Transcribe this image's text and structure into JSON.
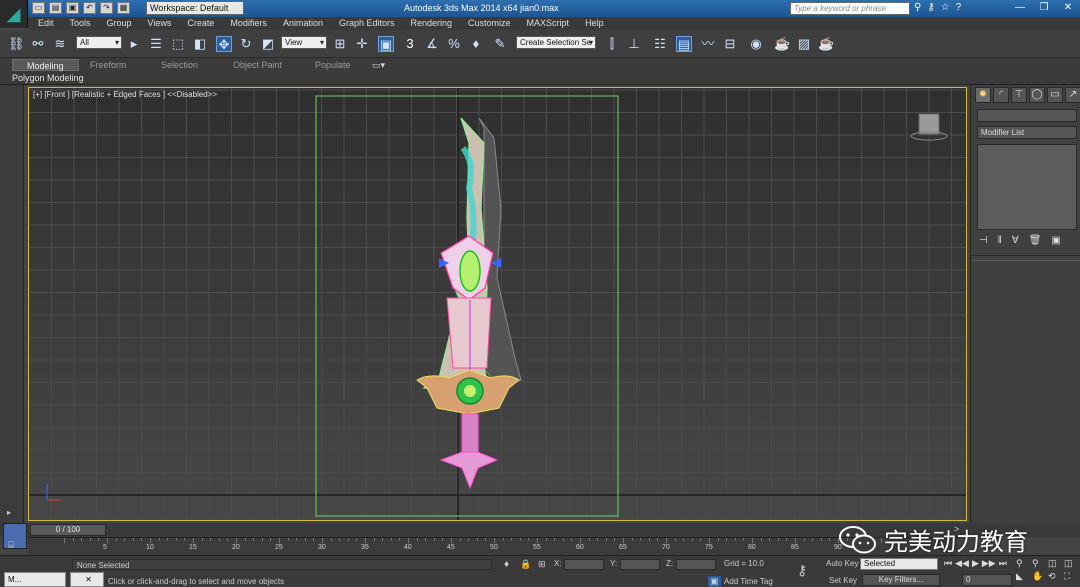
{
  "titlebar": {
    "workspace": "Workspace: Default",
    "title": "Autodesk 3ds Max  2014 x64      jian0.max",
    "search_placeholder": "Type a keyword or phrase"
  },
  "menu": [
    "Edit",
    "Tools",
    "Group",
    "Views",
    "Create",
    "Modifiers",
    "Animation",
    "Graph Editors",
    "Rendering",
    "Customize",
    "MAXScript",
    "Help"
  ],
  "toolbar": {
    "filter_value": "All",
    "refcoord_value": "View",
    "snap_label": "3",
    "named_selection_placeholder": "Create Selection Se"
  },
  "ribbon": {
    "tabs": [
      "Modeling",
      "Freeform",
      "Selection",
      "Object Paint",
      "Populate"
    ],
    "active_tab": "Modeling",
    "panel_title": "Polygon Modeling"
  },
  "viewport": {
    "label": "[+] [Front ] [Realistic + Edged Faces ]  <<Disabled>>"
  },
  "command_panel": {
    "modifier_list_label": "Modifier List"
  },
  "timeline": {
    "slider_label": "0 / 100",
    "ticks": [
      "5",
      "10",
      "15",
      "20",
      "25",
      "30",
      "35",
      "40",
      "45",
      "50",
      "55",
      "60",
      "65",
      "70",
      "75",
      "80",
      "85",
      "90"
    ],
    "right_label": "100"
  },
  "status": {
    "selection": "None Selected",
    "prompt": "Click or click-and-drag to select and move objects",
    "taskbar_button": "M...",
    "x_label": "X:",
    "y_label": "Y:",
    "z_label": "Z:",
    "grid": "Grid = 10.0",
    "add_time_tag": "Add Time Tag",
    "auto_key": "Auto Key",
    "set_key": "Set Key",
    "selected_value": "Selected",
    "key_filters": "Key Filters...",
    "frame_value": "0"
  },
  "watermark": {
    "text": "完美动力教育"
  },
  "colors": {
    "titlebar": "#2d6fb0",
    "viewport_border": "#d6b640",
    "safe_frame": "#6fd36a",
    "active_tool": "#2d5f9c"
  }
}
